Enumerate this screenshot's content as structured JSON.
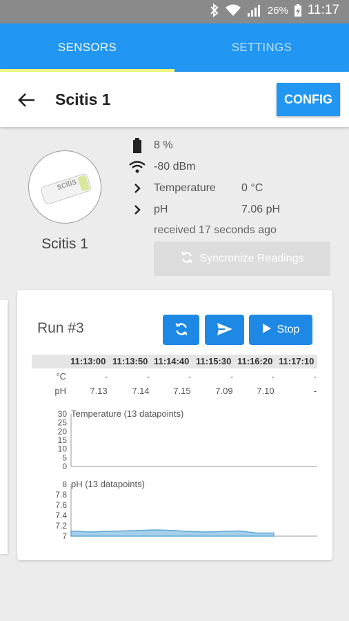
{
  "status_bar": {
    "battery_pct": "26%",
    "time": "11:17"
  },
  "tabs": [
    {
      "label": "SENSORS",
      "active": true
    },
    {
      "label": "SETTINGS",
      "active": false
    }
  ],
  "app_bar": {
    "title": "Scitis 1",
    "config_label": "CONFIG"
  },
  "device": {
    "name": "Scitis 1",
    "logo_text": "scitis",
    "battery": "8 %",
    "signal": "-80 dBm",
    "readings": [
      {
        "label": "Temperature",
        "value": "0 °C"
      },
      {
        "label": "pH",
        "value": "7.06 pH"
      }
    ],
    "received": "received 17 seconds ago",
    "sync_label": "Syncronize Readings"
  },
  "run": {
    "title": "Run #3",
    "stop_label": "Stop",
    "table": {
      "times": [
        "11:13:00",
        "11:13:50",
        "11:14:40",
        "11:15:30",
        "11:16:20",
        "11:17:10"
      ],
      "rows": [
        {
          "label": "°C",
          "values": [
            "-",
            "-",
            "-",
            "-",
            "-",
            "-"
          ]
        },
        {
          "label": "pH",
          "values": [
            "7.13",
            "7.14",
            "7.15",
            "7.09",
            "7.10",
            "-"
          ]
        }
      ]
    }
  },
  "colors": {
    "primary": "#2196f3",
    "tab_indicator": "#f4f67a",
    "area_fill": "#5fa8d8"
  },
  "chart_data": [
    {
      "type": "area",
      "title": "Temperature (13 datapoints)",
      "ylim": [
        0,
        30
      ],
      "yticks": [
        "30",
        "25",
        "20",
        "15",
        "10",
        "5",
        "0"
      ],
      "values": []
    },
    {
      "type": "area",
      "title": "pH (13 datapoints)",
      "ylim": [
        7,
        8
      ],
      "yticks": [
        "8",
        "7.8",
        "7.6",
        "7.4",
        "7.2",
        "7"
      ],
      "values": [
        7.1,
        7.08,
        7.09,
        7.1,
        7.11,
        7.12,
        7.11,
        7.09,
        7.08,
        7.09,
        7.1,
        7.06,
        7.06
      ]
    }
  ]
}
